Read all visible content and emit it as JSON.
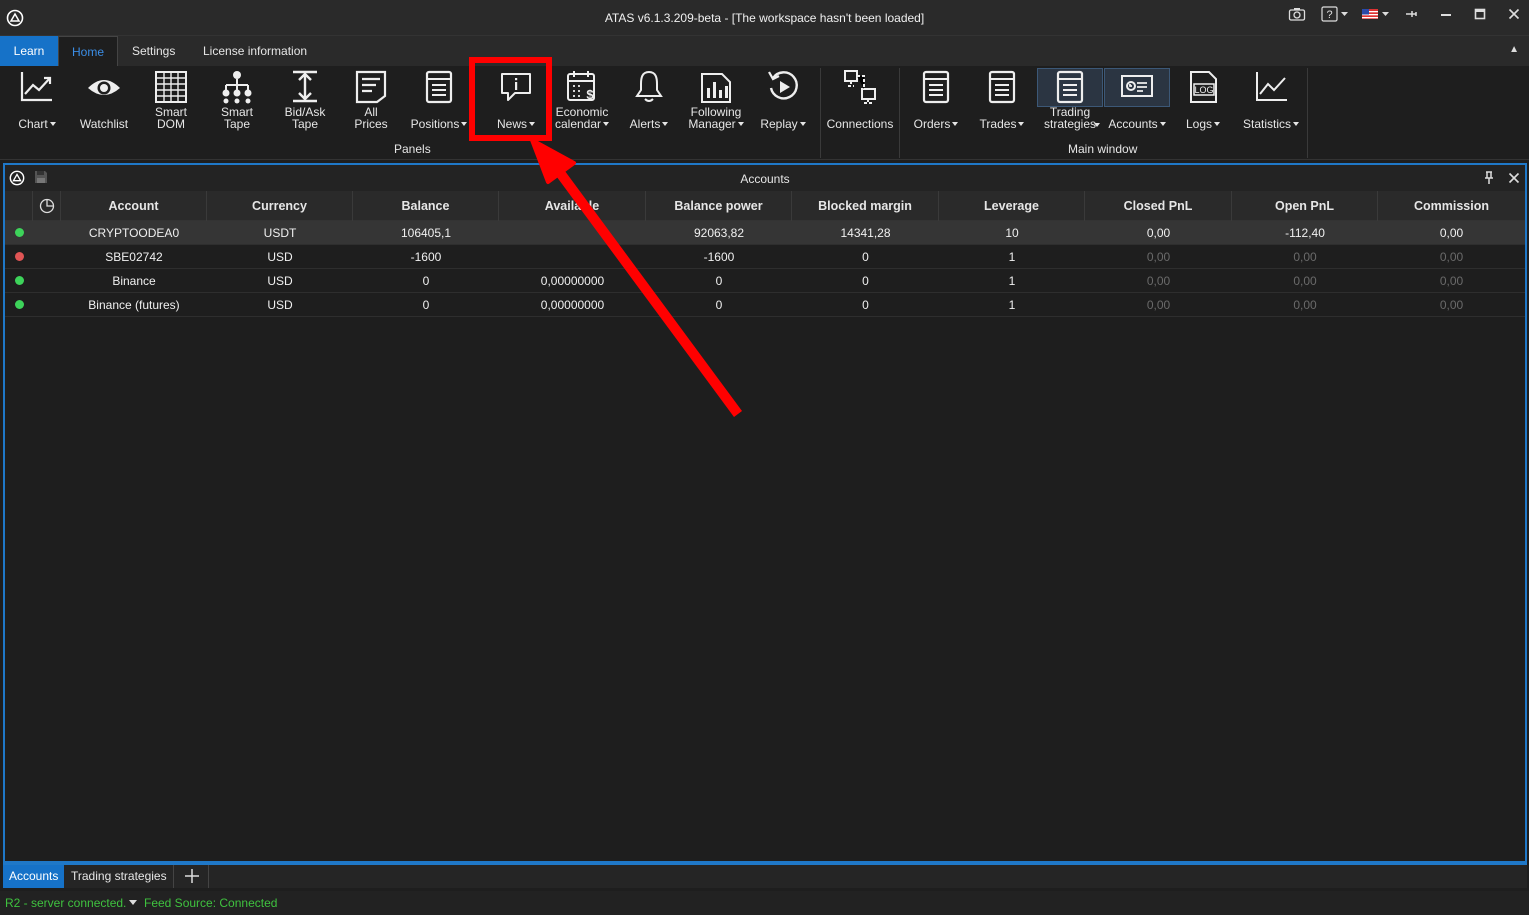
{
  "window": {
    "title": "ATAS v6.1.3.209-beta - [The workspace hasn't been loaded]"
  },
  "ribbon_tabs": [
    "Learn",
    "Home",
    "Settings",
    "License information"
  ],
  "ribbon": {
    "chart": "Chart",
    "watchlist": "Watchlist",
    "smart_dom_1": "Smart",
    "smart_dom_2": "DOM",
    "smart_tape_1": "Smart",
    "smart_tape_2": "Tape",
    "bidask_1": "Bid/Ask",
    "bidask_2": "Tape",
    "allprices_1": "All",
    "allprices_2": "Prices",
    "positions": "Positions",
    "news": "News",
    "econ_1": "Economic",
    "econ_2": "calendar",
    "alerts": "Alerts",
    "following_1": "Following",
    "following_2": "Manager",
    "replay": "Replay",
    "connections": "Connections",
    "orders": "Orders",
    "trades": "Trades",
    "strategies_1": "Trading",
    "strategies_2": "strategies",
    "accounts": "Accounts",
    "logs": "Logs",
    "logs_icon_text": "LOG",
    "statistics": "Statistics",
    "group_panels": "Panels",
    "group_main": "Main window"
  },
  "panel": {
    "title": "Accounts",
    "columns": [
      "Account",
      "Currency",
      "Balance",
      "Available",
      "Balance power",
      "Blocked margin",
      "Leverage",
      "Closed PnL",
      "Open PnL",
      "Commission"
    ],
    "rows": [
      {
        "status": "#3dd35a",
        "account": "CRYPTOODEA0",
        "currency": "USDT",
        "balance": "106405,1",
        "available": "",
        "balance_power": "92063,82",
        "blocked": "14341,28",
        "leverage": "10",
        "closed": "0,00",
        "open": "-112,40",
        "commission": "0,00",
        "dim": false
      },
      {
        "status": "#e05555",
        "account": "SBE02742",
        "currency": "USD",
        "balance": "-1600",
        "available": "",
        "balance_power": "-1600",
        "blocked": "0",
        "leverage": "1",
        "closed": "0,00",
        "open": "0,00",
        "commission": "0,00",
        "dim": true
      },
      {
        "status": "#3dd35a",
        "account": "Binance",
        "currency": "USD",
        "balance": "0",
        "available": "0,00000000",
        "balance_power": "0",
        "blocked": "0",
        "leverage": "1",
        "closed": "0,00",
        "open": "0,00",
        "commission": "0,00",
        "dim": true
      },
      {
        "status": "#3dd35a",
        "account": "Binance (futures)",
        "currency": "USD",
        "balance": "0",
        "available": "0,00000000",
        "balance_power": "0",
        "blocked": "0",
        "leverage": "1",
        "closed": "0,00",
        "open": "0,00",
        "commission": "0,00",
        "dim": true
      }
    ]
  },
  "bottom_tabs": [
    "Accounts",
    "Trading strategies"
  ],
  "status": {
    "server": "R2 - server connected.",
    "feed": "Feed Source: Connected"
  },
  "colors": {
    "accent": "#1672c8",
    "annotation": "#ff0000"
  }
}
